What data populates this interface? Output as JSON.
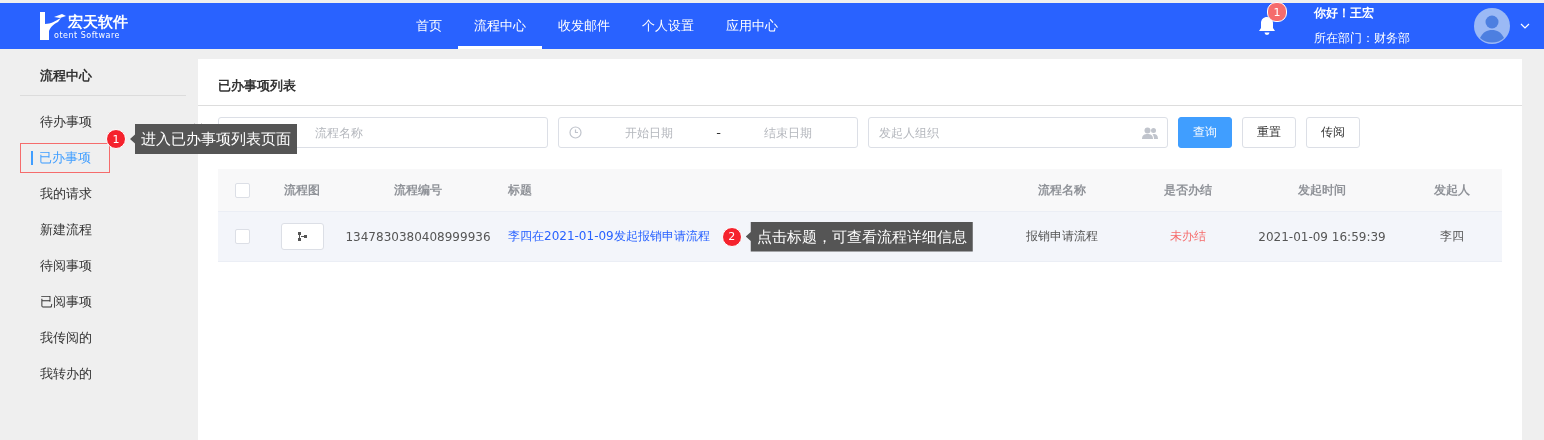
{
  "header": {
    "logo_text": "宏天软件",
    "logo_sub": "otent Software",
    "nav": [
      {
        "label": "首页",
        "selected": false
      },
      {
        "label": "流程中心",
        "selected": true
      },
      {
        "label": "收发邮件",
        "selected": false
      },
      {
        "label": "个人设置",
        "selected": false
      },
      {
        "label": "应用中心",
        "selected": false
      }
    ],
    "notification_count": "1",
    "greeting": "你好！王宏",
    "department": "所在部门：财务部"
  },
  "sidebar": {
    "title": "流程中心",
    "items": [
      {
        "label": "待办事项",
        "selected": false
      },
      {
        "label": "已办事项",
        "selected": true,
        "outlined": true,
        "callout": {
          "number": "1",
          "text": "进入已办事项列表页面"
        }
      },
      {
        "label": "我的请求",
        "selected": false
      },
      {
        "label": "新建流程",
        "selected": false
      },
      {
        "label": "待阅事项",
        "selected": false
      },
      {
        "label": "已阅事项",
        "selected": false
      },
      {
        "label": "我传阅的",
        "selected": false
      },
      {
        "label": "我转办的",
        "selected": false
      }
    ]
  },
  "panel": {
    "title": "已办事项列表",
    "filters": {
      "search_placeholder": "流程名称",
      "start_placeholder": "开始日期",
      "separator": "-",
      "end_placeholder": "结束日期",
      "org_placeholder": "发起人组织"
    },
    "buttons": [
      {
        "label": "查询",
        "kind": "primary"
      },
      {
        "label": "重置",
        "kind": "default"
      },
      {
        "label": "传阅",
        "kind": "default"
      }
    ],
    "table": {
      "select_all_checked": false,
      "columns": [
        "流程图",
        "流程编号",
        "标题",
        "流程名称",
        "是否办结",
        "发起时间",
        "发起人"
      ],
      "rows": [
        {
          "checked": false,
          "number": "1347830380408999936",
          "title": "李四在2021-01-09发起报销申请流程",
          "title_callout": {
            "number": "2",
            "text": "点击标题，可查看流程详细信息"
          },
          "process_name": "报销申请流程",
          "status": "未办结",
          "done": false,
          "started": "2021-01-09 16:59:39",
          "initiator": "李四"
        }
      ]
    }
  }
}
